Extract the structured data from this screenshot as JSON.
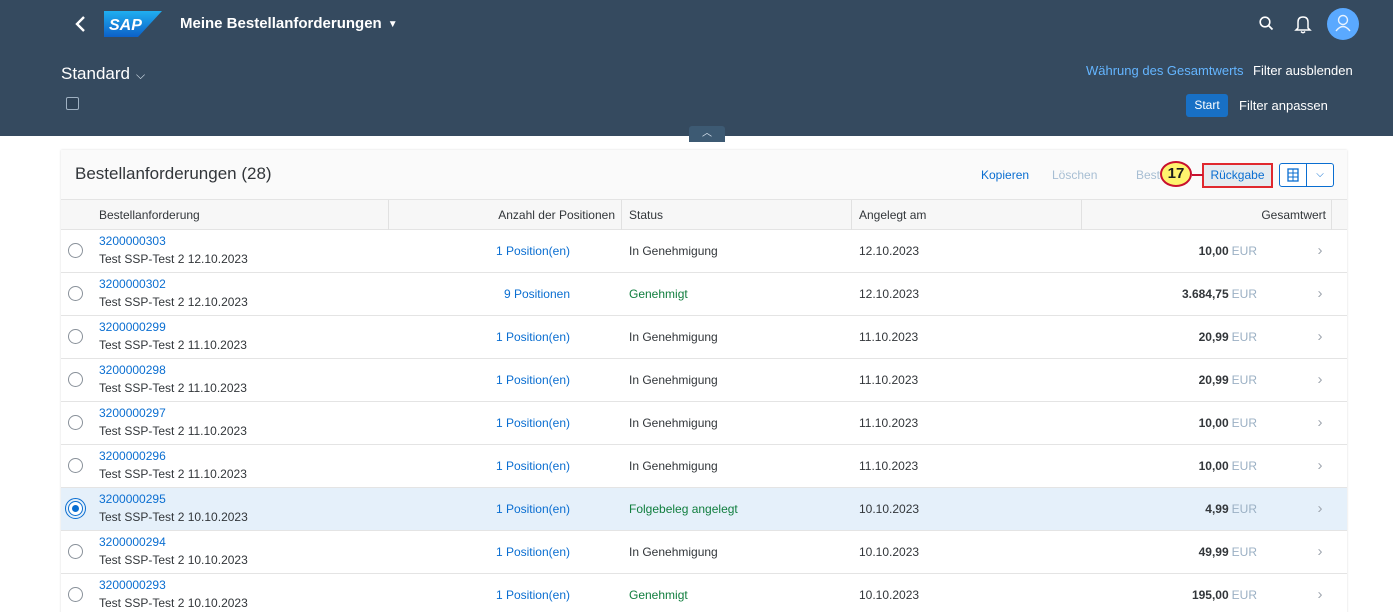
{
  "shell": {
    "back_icon": "chevron-left-icon",
    "logo_text": "SAP",
    "app_title": "Meine Bestellanforderungen",
    "title_caret": "▼",
    "search_icon": "search-icon",
    "notifications_icon": "bell-icon",
    "avatar_icon": "user-avatar-icon"
  },
  "filter": {
    "variant": "Standard",
    "variant_caret": "⌵",
    "currency_link": "Währung des Gesamtwerts",
    "hide_filter": "Filter ausblenden",
    "start_button": "Start",
    "adapt_filter": "Filter anpassen",
    "collapse_icon": "chevron-up-icon",
    "collapse_glyph": "︿"
  },
  "table": {
    "title": "Bestellanforderungen (28)",
    "actions": {
      "copy": "Kopieren",
      "delete": "Löschen",
      "confirm": "Bestätigen",
      "return": "Rückgabe",
      "export_icon": "export-spreadsheet-icon",
      "export_menu_glyph": "⌵"
    },
    "step_badge": "17",
    "columns": {
      "request": "Bestellanforderung",
      "positions": "Anzahl der Positionen",
      "status": "Status",
      "created": "Angelegt am",
      "total": "Gesamtwert"
    },
    "rows": [
      {
        "id": "3200000303",
        "desc": "Test SSP-Test 2 12.10.2023",
        "positions": "1 Position(en)",
        "status": "In Genehmigung",
        "date": "12.10.2023",
        "amount": "10,00",
        "currency": "EUR"
      },
      {
        "id": "3200000302",
        "desc": "Test SSP-Test 2 12.10.2023",
        "positions": "9 Positionen",
        "status": "Genehmigt",
        "date": "12.10.2023",
        "amount": "3.684,75",
        "currency": "EUR"
      },
      {
        "id": "3200000299",
        "desc": "Test SSP-Test 2 11.10.2023",
        "positions": "1 Position(en)",
        "status": "In Genehmigung",
        "date": "11.10.2023",
        "amount": "20,99",
        "currency": "EUR"
      },
      {
        "id": "3200000298",
        "desc": "Test SSP-Test 2 11.10.2023",
        "positions": "1 Position(en)",
        "status": "In Genehmigung",
        "date": "11.10.2023",
        "amount": "20,99",
        "currency": "EUR"
      },
      {
        "id": "3200000297",
        "desc": "Test SSP-Test 2 11.10.2023",
        "positions": "1 Position(en)",
        "status": "In Genehmigung",
        "date": "11.10.2023",
        "amount": "10,00",
        "currency": "EUR"
      },
      {
        "id": "3200000296",
        "desc": "Test SSP-Test 2 11.10.2023",
        "positions": "1 Position(en)",
        "status": "In Genehmigung",
        "date": "11.10.2023",
        "amount": "10,00",
        "currency": "EUR"
      },
      {
        "id": "3200000295",
        "desc": "Test SSP-Test 2 10.10.2023",
        "positions": "1 Position(en)",
        "status": "Folgebeleg angelegt",
        "date": "10.10.2023",
        "amount": "4,99",
        "currency": "EUR"
      },
      {
        "id": "3200000294",
        "desc": "Test SSP-Test 2 10.10.2023",
        "positions": "1 Position(en)",
        "status": "In Genehmigung",
        "date": "10.10.2023",
        "amount": "49,99",
        "currency": "EUR"
      },
      {
        "id": "3200000293",
        "desc": "Test SSP-Test 2 10.10.2023",
        "positions": "1 Position(en)",
        "status": "Genehmigt",
        "date": "10.10.2023",
        "amount": "195,00",
        "currency": "EUR"
      }
    ],
    "row_nav_glyph": "›",
    "row_nav_icon": "chevron-right-icon"
  },
  "colors": {
    "shell_background": "#354a5f",
    "link": "#0a6ed1",
    "positive": "#107e3e",
    "highlight": "#e0282e",
    "badge": "#fff36e"
  }
}
